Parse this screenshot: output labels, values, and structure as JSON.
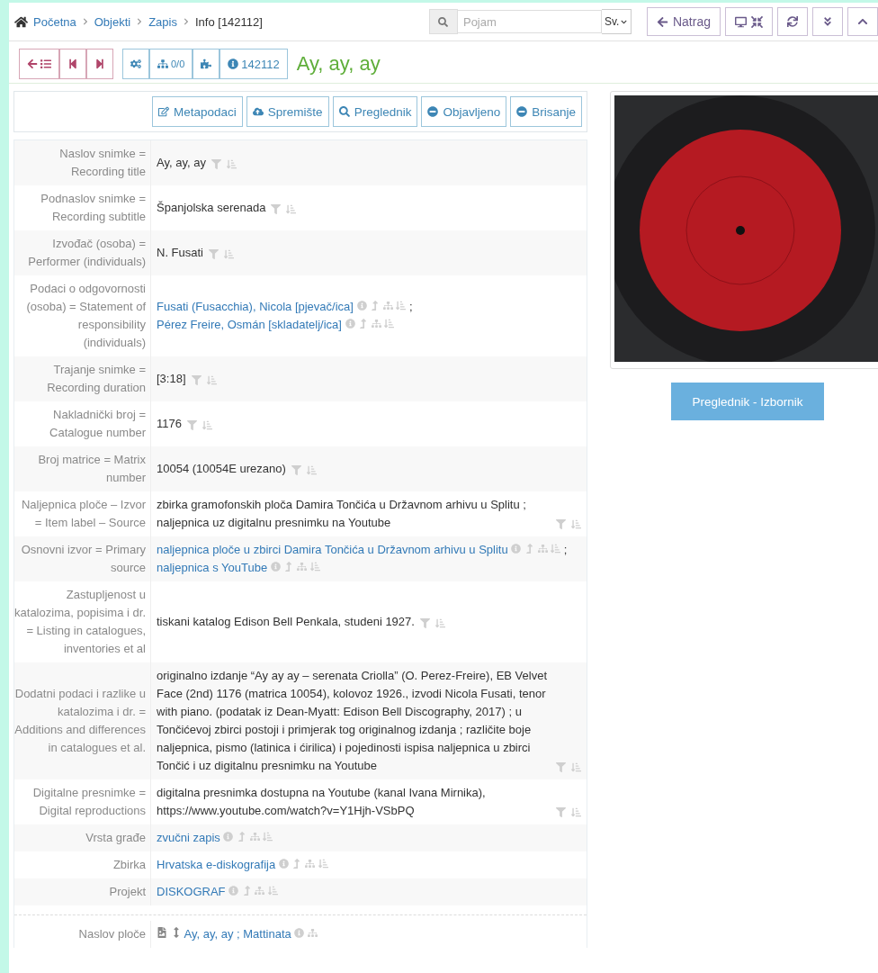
{
  "breadcrumb": [
    {
      "label": "Početna",
      "link": true
    },
    {
      "label": "Objekti",
      "link": true
    },
    {
      "label": "Zapis",
      "link": true
    },
    {
      "label": "Info [142112]",
      "link": false
    }
  ],
  "search": {
    "placeholder": "Pojam",
    "scope": "Sv."
  },
  "back_button": "Natrag",
  "record_toolbar": {
    "hierarchy_count": "0/0",
    "record_id": "142112",
    "title": "Ay, ay, ay"
  },
  "actions": [
    {
      "kind": "edit",
      "label": "Metapodaci"
    },
    {
      "kind": "cloud",
      "label": "Spremište"
    },
    {
      "kind": "search",
      "label": "Preglednik"
    },
    {
      "kind": "minus",
      "label": "Objavljeno"
    },
    {
      "kind": "minus",
      "label": "Brisanje"
    }
  ],
  "fields": [
    {
      "label": "Naslov snimke = Recording title",
      "parts": [
        {
          "kind": "text",
          "text": "Ay, ay, ay"
        }
      ]
    },
    {
      "label": "Podnaslov snimke = Recording subtitle",
      "parts": [
        {
          "kind": "text",
          "text": "Španjolska serenada"
        }
      ]
    },
    {
      "label": "Izvođač (osoba) = Performer (individuals)",
      "parts": [
        {
          "kind": "text",
          "text": "N. Fusati"
        }
      ]
    },
    {
      "label": "Podaci o odgovornosti (osoba) = Statement of responsibility (individuals)",
      "parts": [
        {
          "kind": "link",
          "text": "Fusati (Fusacchia), Nicola [pjevač/ica]"
        },
        {
          "kind": "sep",
          "text": ";"
        },
        {
          "kind": "link",
          "text": "Pérez Freire, Osmán [skladatelj/ica]"
        }
      ]
    },
    {
      "label": "Trajanje snimke = Recording duration",
      "parts": [
        {
          "kind": "text",
          "text": "[3:18]"
        }
      ]
    },
    {
      "label": "Nakladnički broj = Catalogue number",
      "parts": [
        {
          "kind": "text",
          "text": "1176"
        }
      ]
    },
    {
      "label": "Broj matrice = Matrix number",
      "parts": [
        {
          "kind": "text",
          "text": "10054 (10054E urezano)"
        }
      ]
    },
    {
      "label": "Naljepnica ploče – Izvor = Item label – Source",
      "parts": [
        {
          "kind": "text",
          "text": "zbirka gramofonskih ploča Damira Tončića u Državnom arhivu u Splitu ; naljepnica uz digitalnu presnimku na Youtube"
        }
      ]
    },
    {
      "label": "Osnovni izvor = Primary source",
      "parts": [
        {
          "kind": "link",
          "text": "naljepnica ploče u zbirci Damira Tončića u Državnom arhivu u Splitu"
        },
        {
          "kind": "sep",
          "text": ";"
        },
        {
          "kind": "link",
          "text": "naljepnica s YouTube"
        }
      ]
    },
    {
      "label": "Zastupljenost u katalozima, popisima i dr. = Listing in catalogues, inventories et al",
      "parts": [
        {
          "kind": "text",
          "text": "tiskani katalog Edison Bell Penkala, studeni 1927."
        }
      ]
    },
    {
      "label": "Dodatni podaci i razlike u katalozima i dr. = Additions and differences in catalogues et al.",
      "parts": [
        {
          "kind": "text",
          "text": "originalno izdanje “Ay ay ay – serenata Criolla” (O. Perez-Freire), EB Velvet Face (2nd) 1176 (matrica 10054), kolovoz 1926., izvodi Nicola Fusati, tenor with piano. (podatak iz Dean-Myatt: Edison Bell Discography, 2017) ; u Tončićevoj zbirci postoji i primjerak tog originalnog izdanja ; različite boje naljepnica, pismo (latinica i ćirilica) i pojedinosti ispisa naljepnica u zbirci Tončić i uz digitalnu presnimku na Youtube"
        }
      ]
    },
    {
      "label": "Digitalne presnimke = Digital reproductions",
      "parts": [
        {
          "kind": "text",
          "text": "digitalna presnimka dostupna na Youtube (kanal Ivana Mirnika), https://www.youtube.com/watch?v=Y1Hjh-VSbPQ"
        }
      ]
    },
    {
      "label": "Vrsta građe",
      "parts": [
        {
          "kind": "link",
          "text": "zvučni zapis"
        }
      ]
    },
    {
      "label": "Zbirka",
      "parts": [
        {
          "kind": "link",
          "text": "Hrvatska e-diskografija"
        }
      ]
    },
    {
      "label": "Projekt",
      "parts": [
        {
          "kind": "link",
          "text": "DISKOGRAF"
        }
      ]
    }
  ],
  "parent_fields": [
    {
      "label": "Naslov ploče",
      "parts": [
        {
          "kind": "title",
          "text": "Ay, ay, ay ; Mattinata"
        }
      ]
    }
  ],
  "image_button": "Preglednik - Izbornik"
}
